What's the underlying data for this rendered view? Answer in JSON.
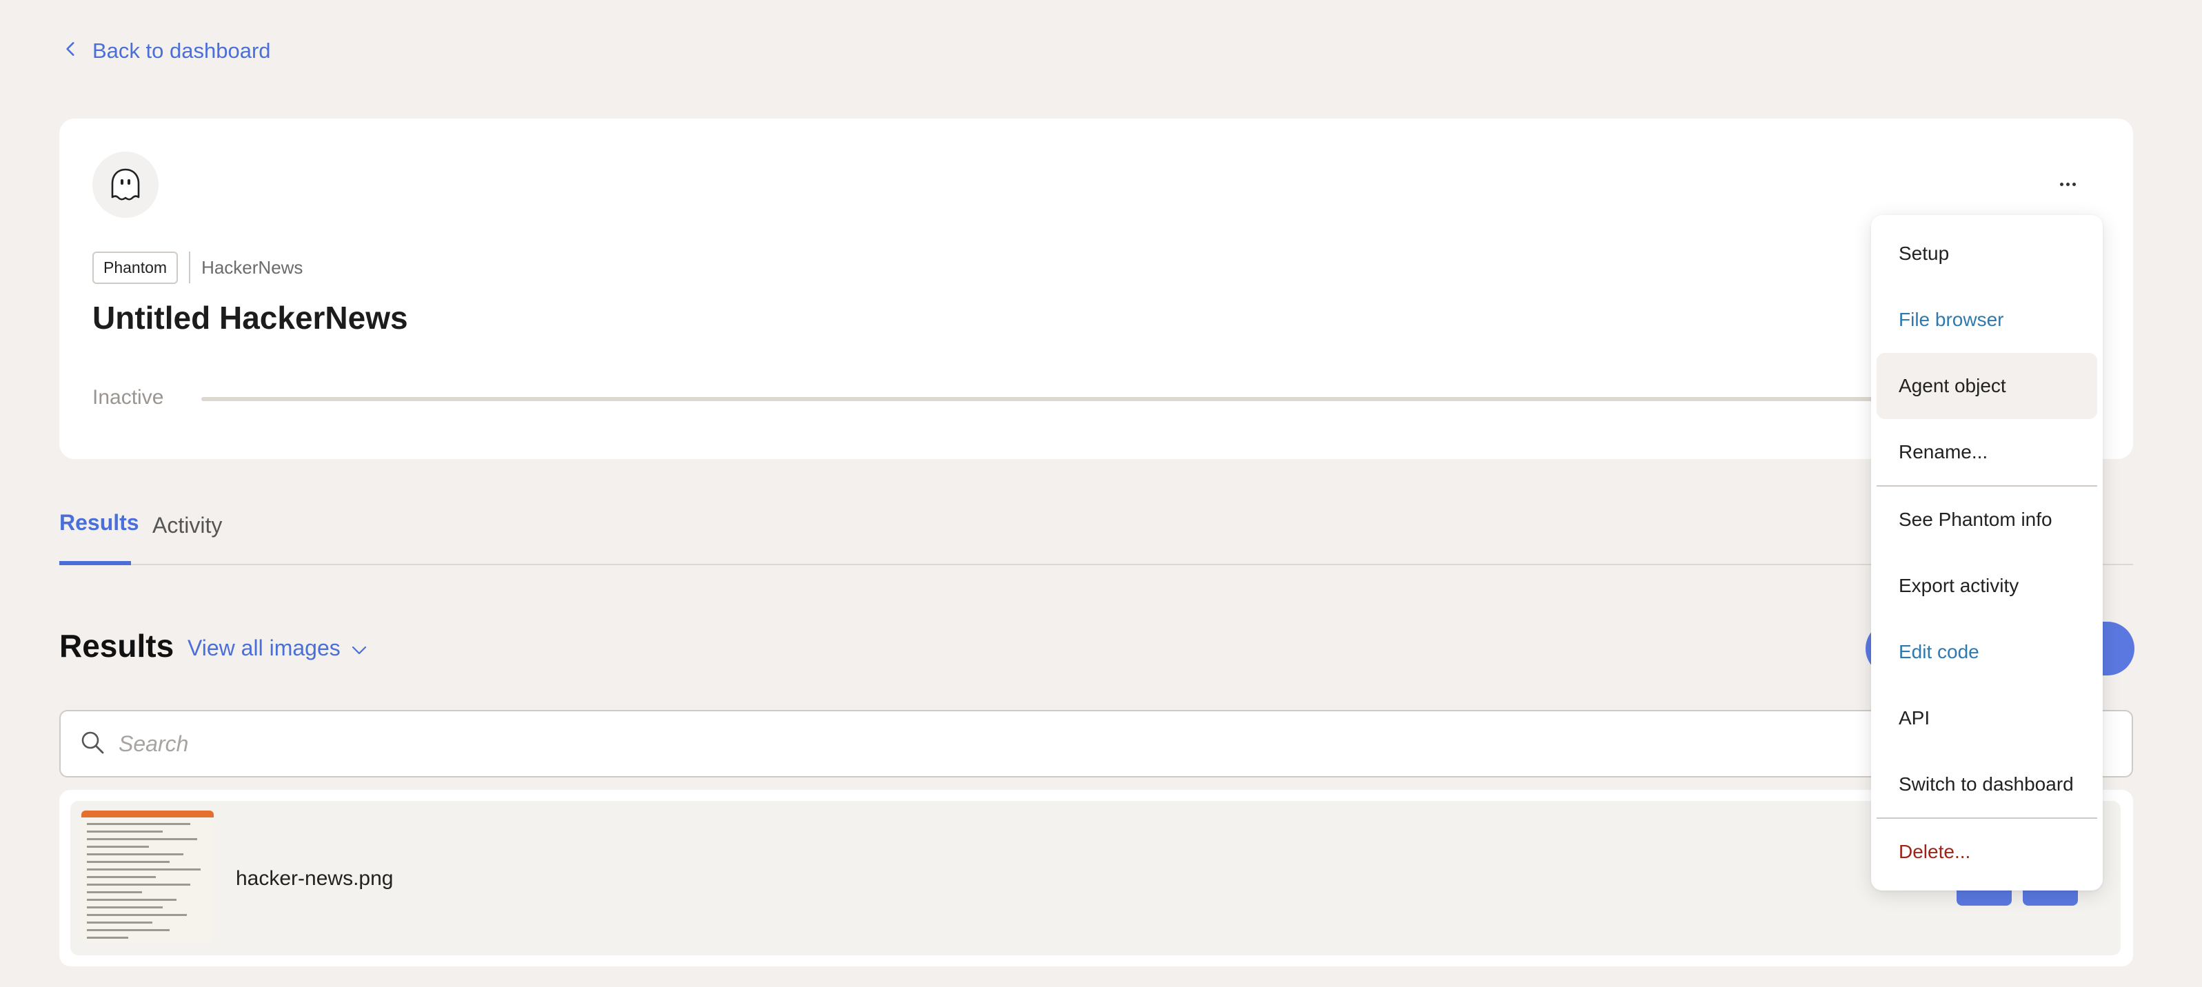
{
  "back_link": {
    "label": "Back to dashboard"
  },
  "agent": {
    "tag": "Phantom",
    "source": "HackerNews",
    "title": "Untitled HackerNews",
    "status": "Inactive"
  },
  "tabs": [
    {
      "label": "Results",
      "active": true
    },
    {
      "label": "Activity",
      "active": false
    }
  ],
  "results": {
    "title": "Results",
    "view_all_label": "View all images",
    "search_placeholder": "Search",
    "items": [
      {
        "file_name": "hacker-news.png"
      }
    ]
  },
  "menu": {
    "items": [
      {
        "label": "Setup"
      },
      {
        "label": "File browser"
      },
      {
        "label": "Agent object"
      },
      {
        "label": "Rename..."
      },
      {
        "label": "See Phantom info"
      },
      {
        "label": "Export activity"
      },
      {
        "label": "Edit code"
      },
      {
        "label": "API"
      },
      {
        "label": "Switch to dashboard"
      },
      {
        "label": "Delete..."
      }
    ]
  },
  "colors": {
    "accent": "#4a6fd8",
    "link_blue": "#2e7ab0",
    "danger": "#9e2418",
    "background": "#f3f0ed"
  }
}
